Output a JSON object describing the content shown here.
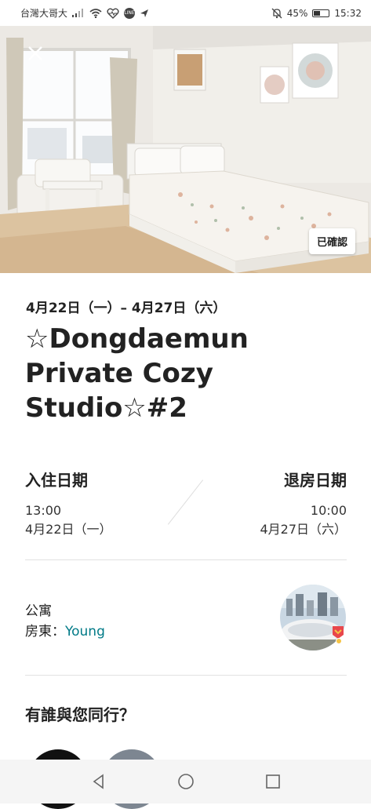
{
  "status_bar": {
    "carrier": "台灣大哥大",
    "battery_percent": "45%",
    "battery_level": 0.45,
    "time": "15:32",
    "line_label": "LINE"
  },
  "listing": {
    "verified_label": "已確認",
    "date_range": "4月22日（一）– 4月27日（六）",
    "title": "☆Dongdaemun Private Cozy Studio☆#2"
  },
  "checkin": {
    "label": "入住日期",
    "time": "13:00",
    "date": "4月22日（一）"
  },
  "checkout": {
    "label": "退房日期",
    "time": "10:00",
    "date": "4月27日（六）"
  },
  "host": {
    "property_type": "公寓",
    "host_label": "房東：",
    "host_name": "Young"
  },
  "companions": {
    "heading": "有誰與您同行？"
  },
  "colors": {
    "accent_link": "#007a87",
    "text_primary": "#222222"
  },
  "icons": [
    "close-icon",
    "back-icon",
    "home-icon",
    "recents-icon",
    "superhost-badge-icon",
    "wifi-icon",
    "signal-icon",
    "mute-icon",
    "battery-icon"
  ]
}
